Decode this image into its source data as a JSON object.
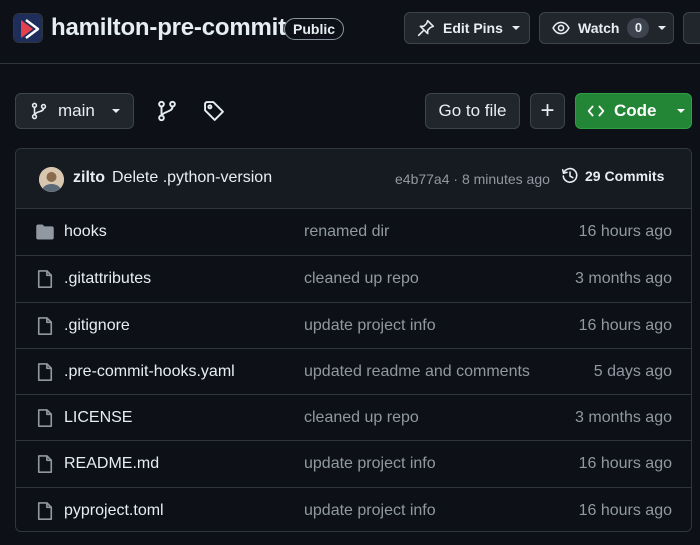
{
  "repo": {
    "name": "hamilton-pre-commit",
    "visibility": "Public"
  },
  "header_actions": {
    "edit_pins_label": "Edit Pins",
    "watch_label": "Watch",
    "watch_count": "0"
  },
  "toolbar": {
    "branch": "main",
    "go_to_file_label": "Go to file",
    "add_label": "+",
    "code_label": "Code"
  },
  "commit": {
    "author": "zilto",
    "message": "Delete .python-version",
    "meta": "e4b77a4 · 8 minutes ago",
    "commits_label": "29 Commits"
  },
  "files": [
    {
      "name": "hooks",
      "type": "folder",
      "commit": "renamed dir",
      "time": "16 hours ago"
    },
    {
      "name": ".gitattributes",
      "type": "file",
      "commit": "cleaned up repo",
      "time": "3 months ago"
    },
    {
      "name": ".gitignore",
      "type": "file",
      "commit": "update project info",
      "time": "16 hours ago"
    },
    {
      "name": ".pre-commit-hooks.yaml",
      "type": "file",
      "commit": "updated readme and comments",
      "time": "5 days ago"
    },
    {
      "name": "LICENSE",
      "type": "file",
      "commit": "cleaned up repo",
      "time": "3 months ago"
    },
    {
      "name": "README.md",
      "type": "file",
      "commit": "update project info",
      "time": "16 hours ago"
    },
    {
      "name": "pyproject.toml",
      "type": "file",
      "commit": "update project info",
      "time": "16 hours ago"
    }
  ],
  "icons": {
    "logo": "hamilton-logo",
    "edit_pins": "pin-icon",
    "watch": "eye-icon",
    "branch": "git-branch-icon",
    "branches": "git-branch-icon",
    "tags": "tag-icon",
    "code": "code-icon",
    "history": "history-icon",
    "folder": "folder-icon",
    "file": "file-icon"
  },
  "colors": {
    "background": "#0d1117",
    "code_button": "#238636",
    "logo_accent": "#e5404e"
  }
}
